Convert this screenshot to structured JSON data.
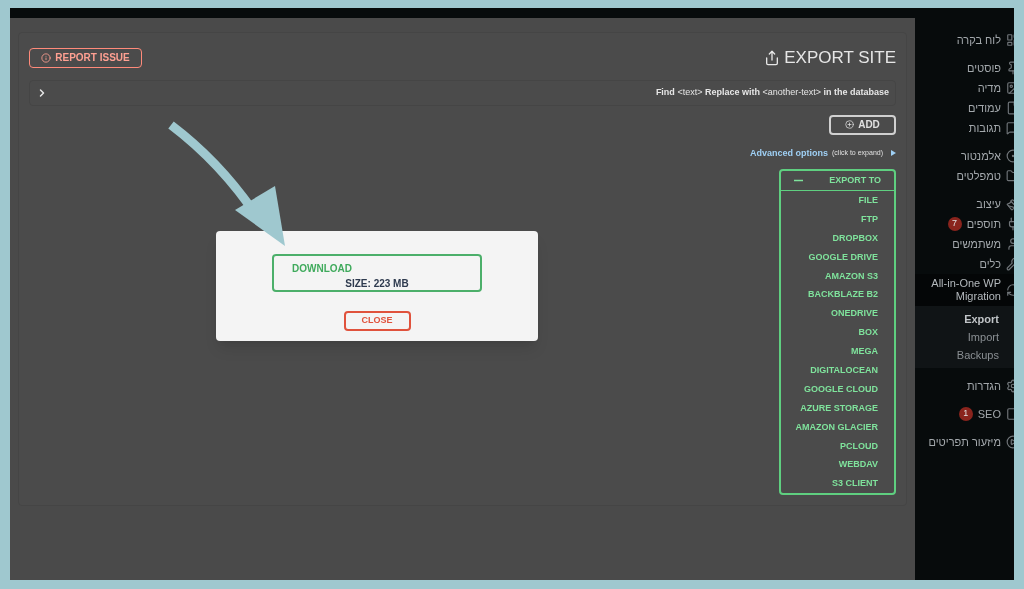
{
  "main": {
    "report_button": "REPORT ISSUE",
    "title": "EXPORT SITE",
    "find_replace": {
      "text": "**Find** <text> **Replace with** <another-text> **in the database**",
      "expanded": false
    },
    "add_button": "ADD",
    "advanced": {
      "link": "Advanced options",
      "note": "(click to expand)"
    },
    "export_to": {
      "title": "EXPORT TO",
      "expanded": true,
      "items": [
        "FILE",
        "FTP",
        "DROPBOX",
        "GOOGLE DRIVE",
        "AMAZON S3",
        "BACKBLAZE B2",
        "ONEDRIVE",
        "BOX",
        "MEGA",
        "DIGITALOCEAN",
        "GOOGLE CLOUD",
        "AZURE STORAGE",
        "AMAZON GLACIER",
        "PCLOUD",
        "WEBDAV",
        "S3 CLIENT"
      ]
    }
  },
  "modal": {
    "download": "DOWNLOAD",
    "size": "SIZE: 223 MB",
    "close_button": "CLOSE"
  },
  "sidebar": {
    "groups": [
      [
        {
          "label": "לוח בקרה",
          "selected": false
        }
      ],
      [
        {
          "label": "פוסטים",
          "selected": false
        },
        {
          "label": "מדיה",
          "selected": false
        },
        {
          "label": "עמודים",
          "selected": false
        },
        {
          "label": "תגובות",
          "selected": false
        }
      ],
      [
        {
          "label": "אלמנטור",
          "selected": false
        },
        {
          "label": "טמפלטים",
          "selected": false
        }
      ],
      [
        {
          "label": "עיצוב",
          "selected": false
        },
        {
          "label": "תוספים",
          "selected": false,
          "badge": "7"
        },
        {
          "label": "משתמשים",
          "selected": false
        },
        {
          "label": "כלים",
          "selected": false
        },
        {
          "label": "All-in-One WP Migration",
          "selected": true,
          "children": [
            {
              "label": "Export",
              "selected": true
            },
            {
              "label": "Import",
              "selected": false
            },
            {
              "label": "Backups",
              "selected": false
            }
          ]
        }
      ],
      [
        {
          "label": "הגדרות",
          "selected": false
        }
      ],
      [
        {
          "label": "SEO",
          "selected": false,
          "badge": "1"
        }
      ],
      [
        {
          "label": "מיזעור תפריטים",
          "selected": false
        }
      ]
    ]
  }
}
